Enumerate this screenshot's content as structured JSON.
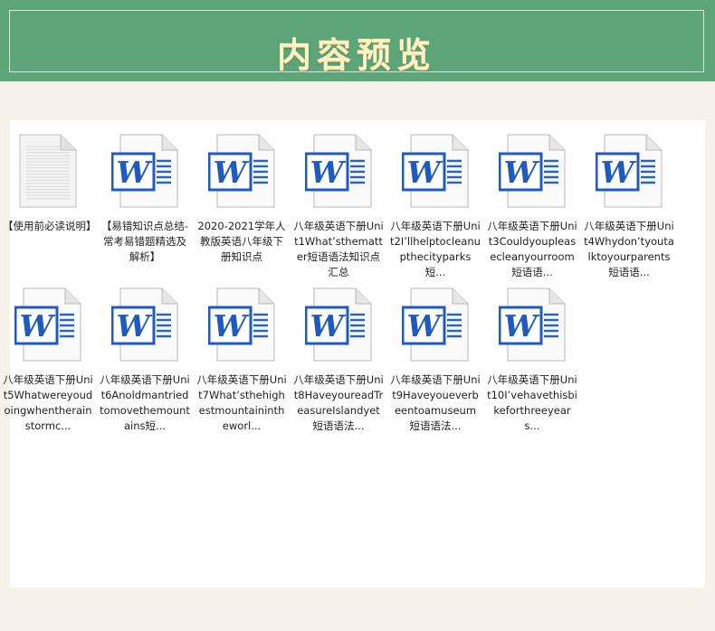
{
  "header": {
    "title": "内容预览"
  },
  "files_row1": [
    {
      "icon": "text-document-icon",
      "label": "【使用前必读说明】"
    },
    {
      "icon": "word-document-icon",
      "label": "【易错知识点总结-常考易错题精选及解析】"
    },
    {
      "icon": "word-document-icon",
      "label": "2020-2021学年人教版英语八年级下册知识点"
    },
    {
      "icon": "word-document-icon",
      "label": "八年级英语下册Unit1What’sthematter短语语法知识点汇总"
    },
    {
      "icon": "word-document-icon",
      "label": "八年级英语下册Unit2I’llhelptocleanupthecityparks短..."
    },
    {
      "icon": "word-document-icon",
      "label": "八年级英语下册Unit3Couldyoupleasecleanyourroom短语语..."
    },
    {
      "icon": "word-document-icon",
      "label": "八年级英语下册Unit4Whydon’tyoutalktoyourparents短语语..."
    }
  ],
  "files_row2": [
    {
      "icon": "word-document-icon",
      "label": "八年级英语下册Unit5Whatwereyoudoingwhentherainstormc..."
    },
    {
      "icon": "word-document-icon",
      "label": "八年级英语下册Unit6Anoldmantriedtomovethemountains短..."
    },
    {
      "icon": "word-document-icon",
      "label": "八年级英语下册Unit7What’sthehighestmountainintheworl..."
    },
    {
      "icon": "word-document-icon",
      "label": "八年级英语下册Unit8HaveyoureadTreasureIslandyet短语语法..."
    },
    {
      "icon": "word-document-icon",
      "label": "八年级英语下册Unit9Haveyoueverbeentoamuseum短语语法..."
    },
    {
      "icon": "word-document-icon",
      "label": "八年级英语下册Unit10I’vehavethisbikeforthreeyears..."
    }
  ]
}
